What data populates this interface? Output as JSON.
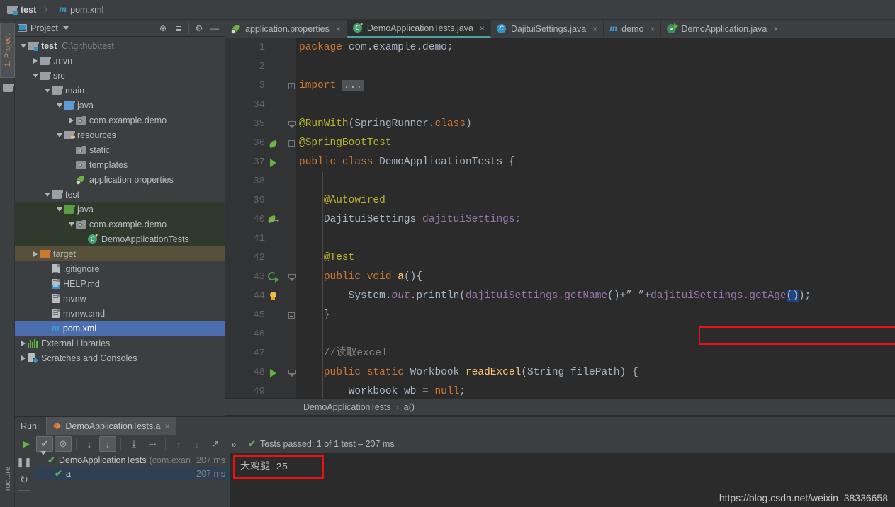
{
  "titlebar": {
    "project_name": "test",
    "file_name": "pom.xml",
    "separator": "〉",
    "folder_icon": "folder-icon",
    "maven_icon": "maven-m-icon"
  },
  "left_strip": {
    "project_tab": "1: Project",
    "structure_tab": "ructure"
  },
  "project_panel": {
    "title": "Project",
    "toolbar_buttons": [
      {
        "name": "locate-icon",
        "glyph": "⊕"
      },
      {
        "name": "collapse-all-icon",
        "glyph": "≣"
      },
      {
        "name": "gear-icon",
        "glyph": "⚙"
      },
      {
        "name": "hide-icon",
        "glyph": "—"
      }
    ],
    "tree": [
      {
        "label": "test",
        "path": "C:\\github\\test",
        "indent": 0,
        "arrow": "down",
        "icon": "folder-module-icon",
        "bold": true,
        "highlight": "none"
      },
      {
        "label": ".mvn",
        "path": "",
        "indent": 1,
        "arrow": "right",
        "icon": "folder-icon",
        "bold": false,
        "highlight": "none"
      },
      {
        "label": "src",
        "path": "",
        "indent": 1,
        "arrow": "down",
        "icon": "folder-icon",
        "bold": false,
        "highlight": "none"
      },
      {
        "label": "main",
        "path": "",
        "indent": 2,
        "arrow": "down",
        "icon": "folder-icon",
        "bold": false,
        "highlight": "none"
      },
      {
        "label": "java",
        "path": "",
        "indent": 3,
        "arrow": "down",
        "icon": "folder-source-icon",
        "bold": false,
        "highlight": "none"
      },
      {
        "label": "com.example.demo",
        "path": "",
        "indent": 4,
        "arrow": "right",
        "icon": "package-icon",
        "bold": false,
        "highlight": "none"
      },
      {
        "label": "resources",
        "path": "",
        "indent": 3,
        "arrow": "down",
        "icon": "folder-resources-icon",
        "bold": false,
        "highlight": "none"
      },
      {
        "label": "static",
        "path": "",
        "indent": 4,
        "arrow": "none",
        "icon": "package-icon",
        "bold": false,
        "highlight": "none"
      },
      {
        "label": "templates",
        "path": "",
        "indent": 4,
        "arrow": "none",
        "icon": "package-icon",
        "bold": false,
        "highlight": "none"
      },
      {
        "label": "application.properties",
        "path": "",
        "indent": 4,
        "arrow": "none",
        "icon": "spring-properties-icon",
        "bold": false,
        "highlight": "none"
      },
      {
        "label": "test",
        "path": "",
        "indent": 2,
        "arrow": "down",
        "icon": "folder-icon",
        "bold": false,
        "highlight": "none"
      },
      {
        "label": "java",
        "path": "",
        "indent": 3,
        "arrow": "down",
        "icon": "folder-test-source-icon",
        "bold": false,
        "highlight": "green"
      },
      {
        "label": "com.example.demo",
        "path": "",
        "indent": 4,
        "arrow": "down",
        "icon": "package-icon",
        "bold": false,
        "highlight": "green"
      },
      {
        "label": "DemoApplicationTests",
        "path": "",
        "indent": 5,
        "arrow": "none",
        "icon": "test-class-icon",
        "bold": false,
        "highlight": "green"
      },
      {
        "label": "target",
        "path": "",
        "indent": 1,
        "arrow": "right",
        "icon": "folder-excluded-icon",
        "bold": false,
        "highlight": "olive"
      },
      {
        "label": ".gitignore",
        "path": "",
        "indent": 2,
        "arrow": "none",
        "icon": "file-icon",
        "bold": false,
        "highlight": "none"
      },
      {
        "label": "HELP.md",
        "path": "",
        "indent": 2,
        "arrow": "none",
        "icon": "markdown-file-icon",
        "bold": false,
        "highlight": "none"
      },
      {
        "label": "mvnw",
        "path": "",
        "indent": 2,
        "arrow": "none",
        "icon": "file-icon",
        "bold": false,
        "highlight": "none"
      },
      {
        "label": "mvnw.cmd",
        "path": "",
        "indent": 2,
        "arrow": "none",
        "icon": "file-icon",
        "bold": false,
        "highlight": "none"
      },
      {
        "label": "pom.xml",
        "path": "",
        "indent": 2,
        "arrow": "none",
        "icon": "maven-m-icon",
        "bold": false,
        "highlight": "selected"
      },
      {
        "label": "External Libraries",
        "path": "",
        "indent": 0,
        "arrow": "right",
        "icon": "libraries-icon",
        "bold": false,
        "highlight": "none"
      },
      {
        "label": "Scratches and Consoles",
        "path": "",
        "indent": 0,
        "arrow": "right",
        "icon": "scratches-icon",
        "bold": false,
        "highlight": "none"
      }
    ]
  },
  "editor": {
    "tabs": [
      {
        "label": "application.properties",
        "icon": "spring-properties-icon",
        "active": false,
        "close": "×"
      },
      {
        "label": "DemoApplicationTests.java",
        "icon": "test-class-icon",
        "active": true,
        "close": "×"
      },
      {
        "label": "DajituiSettings.java",
        "icon": "class-icon",
        "active": false,
        "close": "×"
      },
      {
        "label": "demo",
        "icon": "maven-m-icon",
        "active": false,
        "close": "×"
      },
      {
        "label": "DemoApplication.java",
        "icon": "spring-run-class-icon",
        "active": false,
        "close": "×"
      }
    ],
    "breadcrumb": {
      "class": "DemoApplicationTests",
      "separator": "›",
      "method": "a()"
    },
    "lines": [
      {
        "num": "1",
        "gutter": "",
        "fold": "",
        "indent_guide": false
      },
      {
        "num": "2",
        "gutter": "",
        "fold": "",
        "indent_guide": false
      },
      {
        "num": "3",
        "gutter": "",
        "fold": "plus",
        "indent_guide": false
      },
      {
        "num": "34",
        "gutter": "",
        "fold": "",
        "indent_guide": false
      },
      {
        "num": "35",
        "gutter": "",
        "fold": "tri",
        "indent_guide": false
      },
      {
        "num": "36",
        "gutter": "spring-leaf-icon",
        "fold": "top",
        "indent_guide": false
      },
      {
        "num": "37",
        "gutter": "run-test-icon",
        "fold": "",
        "indent_guide": false
      },
      {
        "num": "38",
        "gutter": "",
        "fold": "",
        "indent_guide": true
      },
      {
        "num": "39",
        "gutter": "",
        "fold": "",
        "indent_guide": true
      },
      {
        "num": "40",
        "gutter": "bean-arrow-icon",
        "fold": "",
        "indent_guide": true
      },
      {
        "num": "41",
        "gutter": "",
        "fold": "",
        "indent_guide": true
      },
      {
        "num": "42",
        "gutter": "",
        "fold": "",
        "indent_guide": true
      },
      {
        "num": "43",
        "gutter": "rerun-icon",
        "fold": "tri",
        "indent_guide": true
      },
      {
        "num": "44",
        "gutter": "lightbulb-icon",
        "fold": "",
        "indent_guide": true
      },
      {
        "num": "45",
        "gutter": "",
        "fold": "top",
        "indent_guide": true
      },
      {
        "num": "46",
        "gutter": "",
        "fold": "",
        "indent_guide": true
      },
      {
        "num": "47",
        "gutter": "",
        "fold": "",
        "indent_guide": true
      },
      {
        "num": "48",
        "gutter": "run-method-icon",
        "fold": "tri",
        "indent_guide": true
      },
      {
        "num": "49",
        "gutter": "",
        "fold": "",
        "indent_guide": true
      }
    ],
    "code": {
      "l1_kw": "package",
      "l1_rest": " com.example.demo;",
      "l3_kw": "import",
      "l3_fold": "...",
      "l35_ann": "@RunWith",
      "l35_open": "(SpringRunner.",
      "l35_kw": "class",
      "l35_close": ")",
      "l36_ann": "@SpringBootTest",
      "l37_kw1": "public class ",
      "l37_name": "DemoApplicationTests ",
      "l37_brace": "{",
      "l39_ann": "@Autowired",
      "l40_type": "DajituiSettings ",
      "l40_field": "dajituiSettings;",
      "l42_ann": "@Test",
      "l43_kw": "public void ",
      "l43_mth": "a",
      "l43_rest": "(){",
      "l44_sys": "System.",
      "l44_out": "out",
      "l44_dot": ".",
      "l44_println": "println",
      "l44_paren1": "(",
      "l44_expr1": "dajituiSettings.",
      "l44_get1": "getName",
      "l44_mid": "()+” ”+",
      "l44_expr2": "dajituiSettings.",
      "l44_get2": "getAge",
      "l44_sel": "()",
      "l44_tail": ");",
      "l45_brace": "}",
      "l47_comment": "//读取excel",
      "l48_kw": "public static ",
      "l48_type": "Workbook ",
      "l48_mth": "readExcel",
      "l48_p1": "(String ",
      "l48_param": "filePath",
      "l48_p2": ") {",
      "l49_type": "Workbook ",
      "l49_var": "wb = ",
      "l49_kw": "null",
      "l49_semi": ";"
    }
  },
  "run_panel": {
    "run_label": "Run:",
    "tab_label": "DemoApplicationTests.a",
    "tab_close": "×",
    "toolbar": [
      {
        "name": "rerun-button",
        "glyph": "▶",
        "state": "normal"
      },
      {
        "name": "show-passed-toggle",
        "glyph": "✔",
        "state": "pressed"
      },
      {
        "name": "show-ignored-toggle",
        "glyph": "⊘",
        "state": "pressed"
      },
      {
        "name": "sort-alphabetically-button",
        "glyph": "↓",
        "state": "normal"
      },
      {
        "name": "sort-by-duration-button",
        "glyph": "↓",
        "state": "pressed"
      },
      {
        "name": "expand-all-button",
        "glyph": "⤓",
        "state": "normal"
      },
      {
        "name": "collapse-all-button",
        "glyph": "⤑",
        "state": "normal"
      },
      {
        "name": "prev-failed-button",
        "glyph": "↑",
        "state": "dim"
      },
      {
        "name": "next-failed-button",
        "glyph": "↓",
        "state": "dim"
      },
      {
        "name": "export-button",
        "glyph": "↗",
        "state": "normal"
      },
      {
        "name": "more-button",
        "glyph": "»",
        "state": "normal"
      }
    ],
    "status": "Tests passed: 1 of 1 test – 207 ms",
    "status_icon": "check-icon",
    "gutter_icons": [
      {
        "name": "mute-breakpoints-icon",
        "glyph": "❙❙"
      },
      {
        "name": "restart-icon",
        "glyph": "↻"
      }
    ],
    "test_tree": [
      {
        "name": "DemoApplicationTests",
        "pkg": "(com.exan",
        "time": "207 ms",
        "indent": 0,
        "arrow": "down",
        "selected": false
      },
      {
        "name": "a",
        "pkg": "",
        "time": "207 ms",
        "indent": 1,
        "arrow": "none",
        "selected": true
      }
    ],
    "console_output": "大鸡腿  25"
  },
  "watermark": "https://blog.csdn.net/weixin_38336658",
  "colors": {
    "accent_blue": "#4b6eaf",
    "green_highlight": "#2f3a2c",
    "olive_highlight": "#57503a",
    "annotation_red": "#ee1111",
    "editor_bg": "#2b2b2b",
    "panel_bg": "#3c3f41"
  }
}
